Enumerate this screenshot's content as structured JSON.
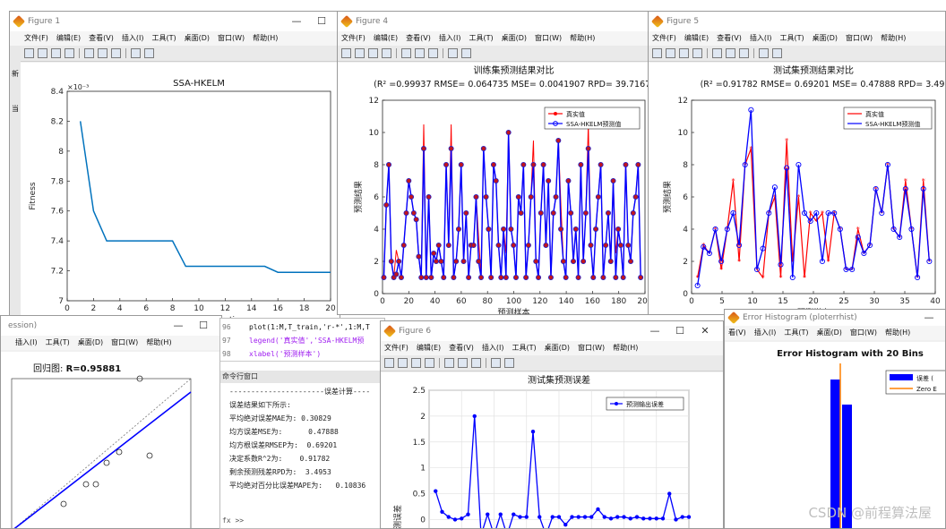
{
  "figure1": {
    "title": "Figure 1",
    "menus": [
      "文件(F)",
      "编辑(E)",
      "查看(V)",
      "插入(I)",
      "工具(T)",
      "桌面(D)",
      "窗口(W)",
      "帮助(H)"
    ],
    "left_clip": [
      "新",
      "当"
    ],
    "chart_data": {
      "type": "line",
      "title": "SSA-HKELM",
      "xlabel": "The number of iterations",
      "ylabel": "Fitness",
      "exponent": "×10⁻³",
      "x": [
        1,
        2,
        3,
        4,
        5,
        6,
        7,
        8,
        9,
        10,
        11,
        12,
        13,
        14,
        15,
        16,
        17,
        18,
        19,
        20
      ],
      "y": [
        8.2,
        7.6,
        7.4,
        7.4,
        7.4,
        7.4,
        7.4,
        7.4,
        7.23,
        7.23,
        7.23,
        7.23,
        7.23,
        7.23,
        7.23,
        7.19,
        7.19,
        7.19,
        7.19,
        7.19
      ],
      "xlim": [
        0,
        20
      ],
      "ylim": [
        7,
        8.4
      ],
      "xticks": [
        "0",
        "2",
        "4",
        "6",
        "8",
        "10",
        "12",
        "14",
        "16",
        "18",
        "20"
      ],
      "yticks": [
        "7",
        "7.2",
        "7.4",
        "7.6",
        "7.8",
        "8",
        "8.2",
        "8.4"
      ],
      "color": "#0072bd"
    }
  },
  "figure4": {
    "title": "Figure 4",
    "menus": [
      "文件(F)",
      "编辑(E)",
      "查看(V)",
      "插入(I)",
      "工具(T)",
      "桌面(D)",
      "窗口(W)",
      "帮助(H)"
    ],
    "chart_data": {
      "type": "line",
      "title": "训练集预测结果对比",
      "subtitle": "(R² =0.99937 RMSE= 0.064735 MSE= 0.0041907 RPD= 39.7167)",
      "xlabel": "预测样本",
      "ylabel": "预测结果",
      "xlim": [
        0,
        200
      ],
      "ylim": [
        0,
        12
      ],
      "xticks": [
        "0",
        "20",
        "40",
        "60",
        "80",
        "100",
        "120",
        "140",
        "160",
        "180",
        "200"
      ],
      "yticks": [
        "0",
        "2",
        "4",
        "6",
        "8",
        "10",
        "12"
      ],
      "series": [
        {
          "name": "真实值",
          "color": "#ff0000"
        },
        {
          "name": "SSA-HKELM预测值",
          "color": "#0000ff"
        }
      ],
      "y": [
        1,
        5.5,
        8,
        2,
        1,
        1.2,
        2,
        1,
        3,
        5,
        7,
        6,
        5,
        4.6,
        2.3,
        1,
        9,
        1,
        6,
        1,
        2.5,
        2,
        3,
        2,
        1,
        8,
        3,
        9,
        1,
        2,
        4,
        8,
        2,
        5,
        1,
        3,
        3,
        6,
        2,
        1,
        9,
        6,
        4,
        1,
        8,
        7,
        3,
        1,
        4,
        1,
        10,
        4,
        3,
        1,
        6,
        5,
        8,
        1,
        3,
        6,
        8,
        2,
        1,
        5,
        8,
        3,
        7,
        1,
        5,
        6,
        9.5,
        4,
        2,
        1,
        7,
        5,
        2,
        4,
        1,
        8,
        2,
        5,
        9,
        3,
        1,
        4,
        6,
        8,
        1,
        3,
        5,
        2,
        7,
        1,
        4,
        3,
        1,
        8,
        3,
        2,
        5,
        6,
        8,
        1
      ]
    }
  },
  "figure5": {
    "title": "Figure 5",
    "menus": [
      "文件(F)",
      "编辑(E)",
      "查看(V)",
      "插入(I)",
      "工具(T)",
      "桌面(D)",
      "窗口(W)",
      "帮助(H)"
    ],
    "chart_data": {
      "type": "line",
      "title": "测试集预测结果对比",
      "subtitle": "(R² =0.91782 RMSE= 0.69201 MSE= 0.47888 RPD= 3.49",
      "xlabel": "预测样本",
      "ylabel": "预测结果",
      "xlim": [
        0,
        41
      ],
      "ylim": [
        0,
        12
      ],
      "xticks": [
        "0",
        "5",
        "10",
        "15",
        "20",
        "25",
        "30",
        "35",
        "40"
      ],
      "yticks": [
        "0",
        "2",
        "4",
        "6",
        "8",
        "10",
        "12"
      ],
      "series": [
        {
          "name": "真实值",
          "color": "#ff0000",
          "values": [
            1,
            3,
            2.5,
            4,
            1.5,
            4,
            7,
            2,
            8,
            9,
            1.5,
            1,
            5,
            6,
            1,
            9.5,
            2,
            6,
            1,
            5,
            4.5,
            5,
            2,
            5,
            4,
            1.5,
            1.5,
            4,
            2.5,
            3,
            6.5,
            5,
            8,
            4,
            3.5,
            7,
            4,
            1,
            7,
            2
          ]
        },
        {
          "name": "SSA-HKELM预测值",
          "color": "#0000ff",
          "values": [
            0.5,
            2.9,
            2.5,
            4,
            2,
            4,
            5,
            3,
            8,
            11.4,
            1.5,
            2.8,
            5,
            6.6,
            1.8,
            7.8,
            1,
            8,
            5,
            4.5,
            5,
            2,
            5,
            5,
            4,
            1.5,
            1.5,
            3.5,
            2.5,
            3,
            6.5,
            5,
            8,
            4,
            3.5,
            6.5,
            4,
            1,
            6.5,
            2
          ]
        }
      ]
    }
  },
  "regression": {
    "title": "ession)",
    "menus": [
      "插入(I)",
      "工具(T)",
      "桌面(D)",
      "窗口(W)",
      "帮助(H)"
    ],
    "chart_title_prefix": "回归图: ",
    "chart_title_value": "R=0.95881"
  },
  "commandwindow": {
    "lines": [
      {
        "no": "96",
        "code": "plot(1:M,T_train,'r-*',1:M,T"
      },
      {
        "no": "97",
        "code": "legend('真实值','SSA-HKELM预"
      },
      {
        "no": "98",
        "code": "xlabel('预测样本')"
      }
    ],
    "header": "命令行窗口",
    "output": "----------------------误差计算----\n误差结果如下所示:\n平均绝对误差MAE为: 0.30829\n均方误差MSE为:      0.47888\n均方根误差RMSEP为:  0.69201\n决定系数R^2为:    0.91782\n剩余预测残差RPD为:  3.4953\n平均绝对百分比误差MAPE为:   0.10836",
    "prompt": "fx >>"
  },
  "figure6": {
    "title": "Figure 6",
    "menus": [
      "文件(F)",
      "编辑(E)",
      "查看(V)",
      "插入(I)",
      "工具(T)",
      "桌面(D)",
      "窗口(W)",
      "帮助(H)"
    ],
    "chart_data": {
      "type": "line",
      "title": "测试集预测误差",
      "ylabel": "预测误差",
      "xlim": [
        0,
        40
      ],
      "ylim": [
        -0.2,
        2.5
      ],
      "yticks": [
        "0",
        "0.5",
        "1",
        "1.5",
        "2",
        "2.5"
      ],
      "series": [
        {
          "name": "预测输出误差",
          "color": "#0000ff",
          "values": [
            0.55,
            0.15,
            0.05,
            0,
            0.02,
            0.1,
            2,
            -0.3,
            0.1,
            -0.3,
            0.1,
            -0.3,
            0.1,
            0.05,
            0.05,
            1.7,
            0.05,
            -0.3,
            0.05,
            0.05,
            -0.1,
            0.05,
            0.05,
            0.05,
            0.05,
            0.2,
            0.05,
            0.02,
            0.05,
            0.05,
            0.02,
            0.05,
            0.02,
            0.02,
            0.02,
            0.02,
            0.5,
            0,
            0.05,
            0.05
          ]
        }
      ]
    }
  },
  "errhist": {
    "title": "Error Histogram (ploterrhist)",
    "menus": [
      "看(V)",
      "插入(I)",
      "工具(T)",
      "桌面(D)",
      "窗口(W)",
      "帮助(H)"
    ],
    "chart_data": {
      "type": "bar",
      "title": "Error Histogram with 20 Bins",
      "legend": [
        "误差 (",
        "Zero E"
      ]
    }
  },
  "watermark": "CSDN @前程算法屋"
}
